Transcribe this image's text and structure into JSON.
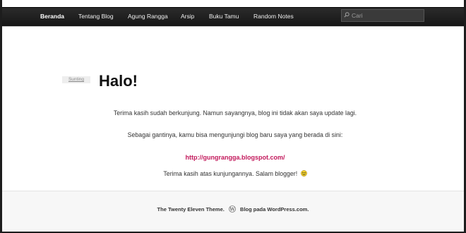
{
  "nav": {
    "items": [
      {
        "label": "Beranda"
      },
      {
        "label": "Tentang Blog"
      },
      {
        "label": "Agung Rangga"
      },
      {
        "label": "Arsip"
      },
      {
        "label": "Buku Tamu"
      },
      {
        "label": "Random Notes"
      }
    ],
    "search_placeholder": "Cari",
    "search_icon": "search-icon"
  },
  "post": {
    "edit_label": "Sunting",
    "title": "Halo!",
    "para1": "Terima kasih sudah berkunjung. Namun sayangnya, blog ini tidak akan saya update lagi.",
    "para2": "Sebagai gantinya, kamu bisa mengunjungi blog baru saya yang berada di sini:",
    "link": "http://gungrangga.blogspot.com/",
    "para3": "Terima kasih atas kunjungannya. Salam blogger!",
    "smiley_icon": "smiley-icon"
  },
  "footer": {
    "theme_text": "The Twenty Eleven Theme.",
    "wp_icon": "wordpress-icon",
    "blog_text": "Blog pada WordPress.com."
  },
  "colors": {
    "link": "#c2185b",
    "nav_bg": "#222222",
    "page_bg": "#1d1d1d"
  }
}
